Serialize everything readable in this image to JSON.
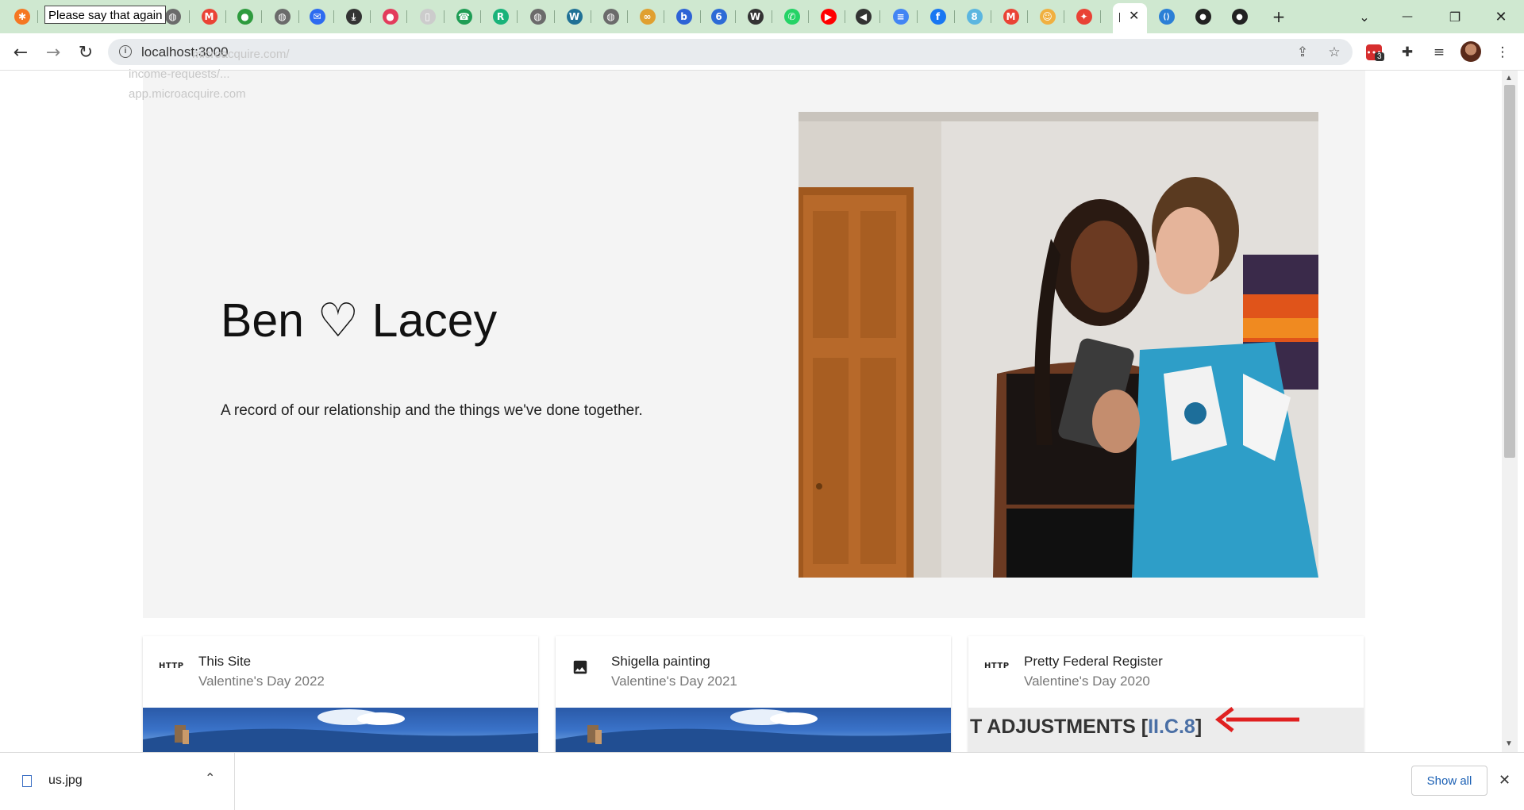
{
  "browser": {
    "tooltip": "Please say that again",
    "address": "localhost:3000",
    "autocomplete_ghost": [
      "microacquire.com/",
      "income-requests/...",
      "app.microacquire.com"
    ],
    "tabs": [
      {
        "icon": "hubspot-icon",
        "color": "#f57722",
        "glyph": "✱"
      },
      {
        "icon": "globe-icon",
        "color": "#6b6b6b",
        "glyph": "◍"
      },
      {
        "icon": "gmail-icon",
        "color": "#ea4335",
        "glyph": "M"
      },
      {
        "icon": "green-app-icon",
        "color": "#2e9b3e",
        "glyph": "●"
      },
      {
        "icon": "globe-icon",
        "color": "#6b6b6b",
        "glyph": "◍"
      },
      {
        "icon": "messenger-icon",
        "color": "#2d6bf0",
        "glyph": "✉"
      },
      {
        "icon": "download-icon",
        "color": "#333333",
        "glyph": "⤓"
      },
      {
        "icon": "badge-app-icon",
        "color": "#e33c5c",
        "glyph": "●"
      },
      {
        "icon": "document-icon",
        "color": "#cccccc",
        "glyph": "▯"
      },
      {
        "icon": "phone-icon",
        "color": "#1f9d55",
        "glyph": "☎"
      },
      {
        "icon": "r-app-icon",
        "color": "#19b37a",
        "glyph": "R"
      },
      {
        "icon": "globe-icon",
        "color": "#6b6b6b",
        "glyph": "◍"
      },
      {
        "icon": "wordpress-icon",
        "color": "#207196",
        "glyph": "W"
      },
      {
        "icon": "globe-icon",
        "color": "#6b6b6b",
        "glyph": "◍"
      },
      {
        "icon": "sync-icon",
        "color": "#e0a030",
        "glyph": "∞"
      },
      {
        "icon": "b-app-icon",
        "color": "#2d63d6",
        "glyph": "b"
      },
      {
        "icon": "calendar-icon",
        "color": "#2d6bd6",
        "glyph": "6"
      },
      {
        "icon": "wikipedia-icon",
        "color": "#333333",
        "glyph": "W"
      },
      {
        "icon": "whatsapp-icon",
        "color": "#25d366",
        "glyph": "✆"
      },
      {
        "icon": "youtube-icon",
        "color": "#ff0000",
        "glyph": "▶"
      },
      {
        "icon": "audio-icon",
        "color": "#333333",
        "glyph": "◀"
      },
      {
        "icon": "docs-icon",
        "color": "#4285f4",
        "glyph": "≡"
      },
      {
        "icon": "facebook-icon",
        "color": "#1877f2",
        "glyph": "f"
      },
      {
        "icon": "eight-app-icon",
        "color": "#5bb6e0",
        "glyph": "8"
      },
      {
        "icon": "gmail-icon",
        "color": "#ea4335",
        "glyph": "M"
      },
      {
        "icon": "person-icon",
        "color": "#f0b040",
        "glyph": "☺"
      },
      {
        "icon": "pinwheel-icon",
        "color": "#e94235",
        "glyph": "✦"
      }
    ],
    "tabs_after": [
      {
        "icon": "vscode-icon",
        "color": "#2b7fd6",
        "glyph": "⟨⟩"
      },
      {
        "icon": "github-icon",
        "color": "#222222",
        "glyph": "●"
      },
      {
        "icon": "github-icon",
        "color": "#222222",
        "glyph": "●"
      }
    ],
    "new_tab": "+",
    "window": {
      "minimize": "—",
      "restore": "❐",
      "close": "✕",
      "dropdown": "⌄"
    },
    "nav": {
      "back": "←",
      "forward": "→",
      "reload": "↻",
      "info": "i"
    },
    "extensions_badge": "3"
  },
  "hero": {
    "title": "Ben ♡ Lacey",
    "subtitle": "A record of our relationship and the things we've done together."
  },
  "cards": [
    {
      "icon_label": "HTTP",
      "icon": "http-icon",
      "title": "This Site",
      "subtitle": "Valentine's Day 2022",
      "thumb": "sky"
    },
    {
      "icon_label": "",
      "icon": "image-icon",
      "title": "Shigella painting",
      "subtitle": "Valentine's Day 2021",
      "thumb": "sky"
    },
    {
      "icon_label": "HTTP",
      "icon": "http-icon",
      "title": "Pretty Federal Register",
      "subtitle": "Valentine's Day 2020",
      "thumb": "fed",
      "thumb_text": "T ADJUSTMENTS [",
      "thumb_link": "II.C.8",
      "thumb_close": "]"
    }
  ],
  "downloads": {
    "file_name": "us.jpg",
    "show_all": "Show all"
  },
  "colors": {
    "tab_strip": "#cfe8d0",
    "hero_bg": "#f4f4f4",
    "link": "#1a5fb4",
    "arrow": "#e02020"
  }
}
